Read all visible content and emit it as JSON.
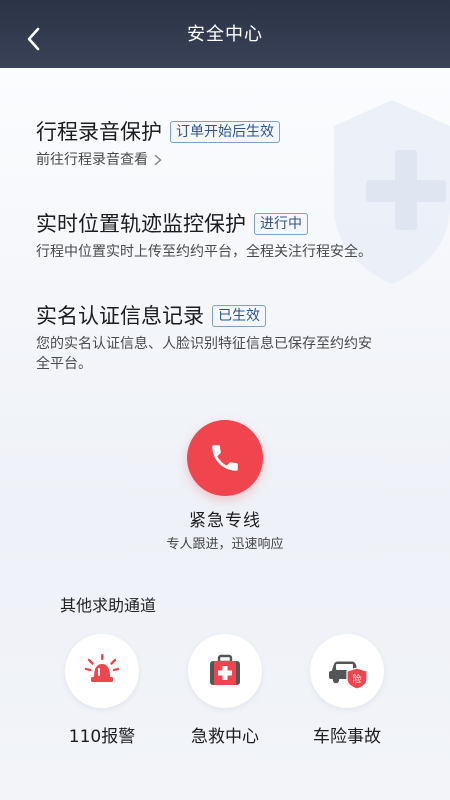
{
  "header": {
    "title": "安全中心",
    "back_icon": "chevron-left-icon"
  },
  "sections": [
    {
      "title": "行程录音保护",
      "tag": "订单开始后生效",
      "link": "前往行程录音查看"
    },
    {
      "title": "实时位置轨迹监控保护",
      "tag": "进行中",
      "desc": "行程中位置实时上传至约约平台，全程关注行程安全。"
    },
    {
      "title": "实名认证信息记录",
      "tag": "已生效",
      "desc_line1": "您的实名认证信息、人脸识别特征信息已保存至约约安",
      "desc_line2": "全平台。"
    }
  ],
  "emergency": {
    "title": "紧急专线",
    "subtitle": "专人跟进，迅速响应",
    "accent": "#f0454f"
  },
  "other_channels": {
    "title": "其他求助通道",
    "items": [
      {
        "label": "110报警",
        "icon": "police-siren-icon"
      },
      {
        "label": "急救中心",
        "icon": "first-aid-kit-icon"
      },
      {
        "label": "车险事故",
        "icon": "car-insurance-icon",
        "badge": "险"
      }
    ]
  }
}
